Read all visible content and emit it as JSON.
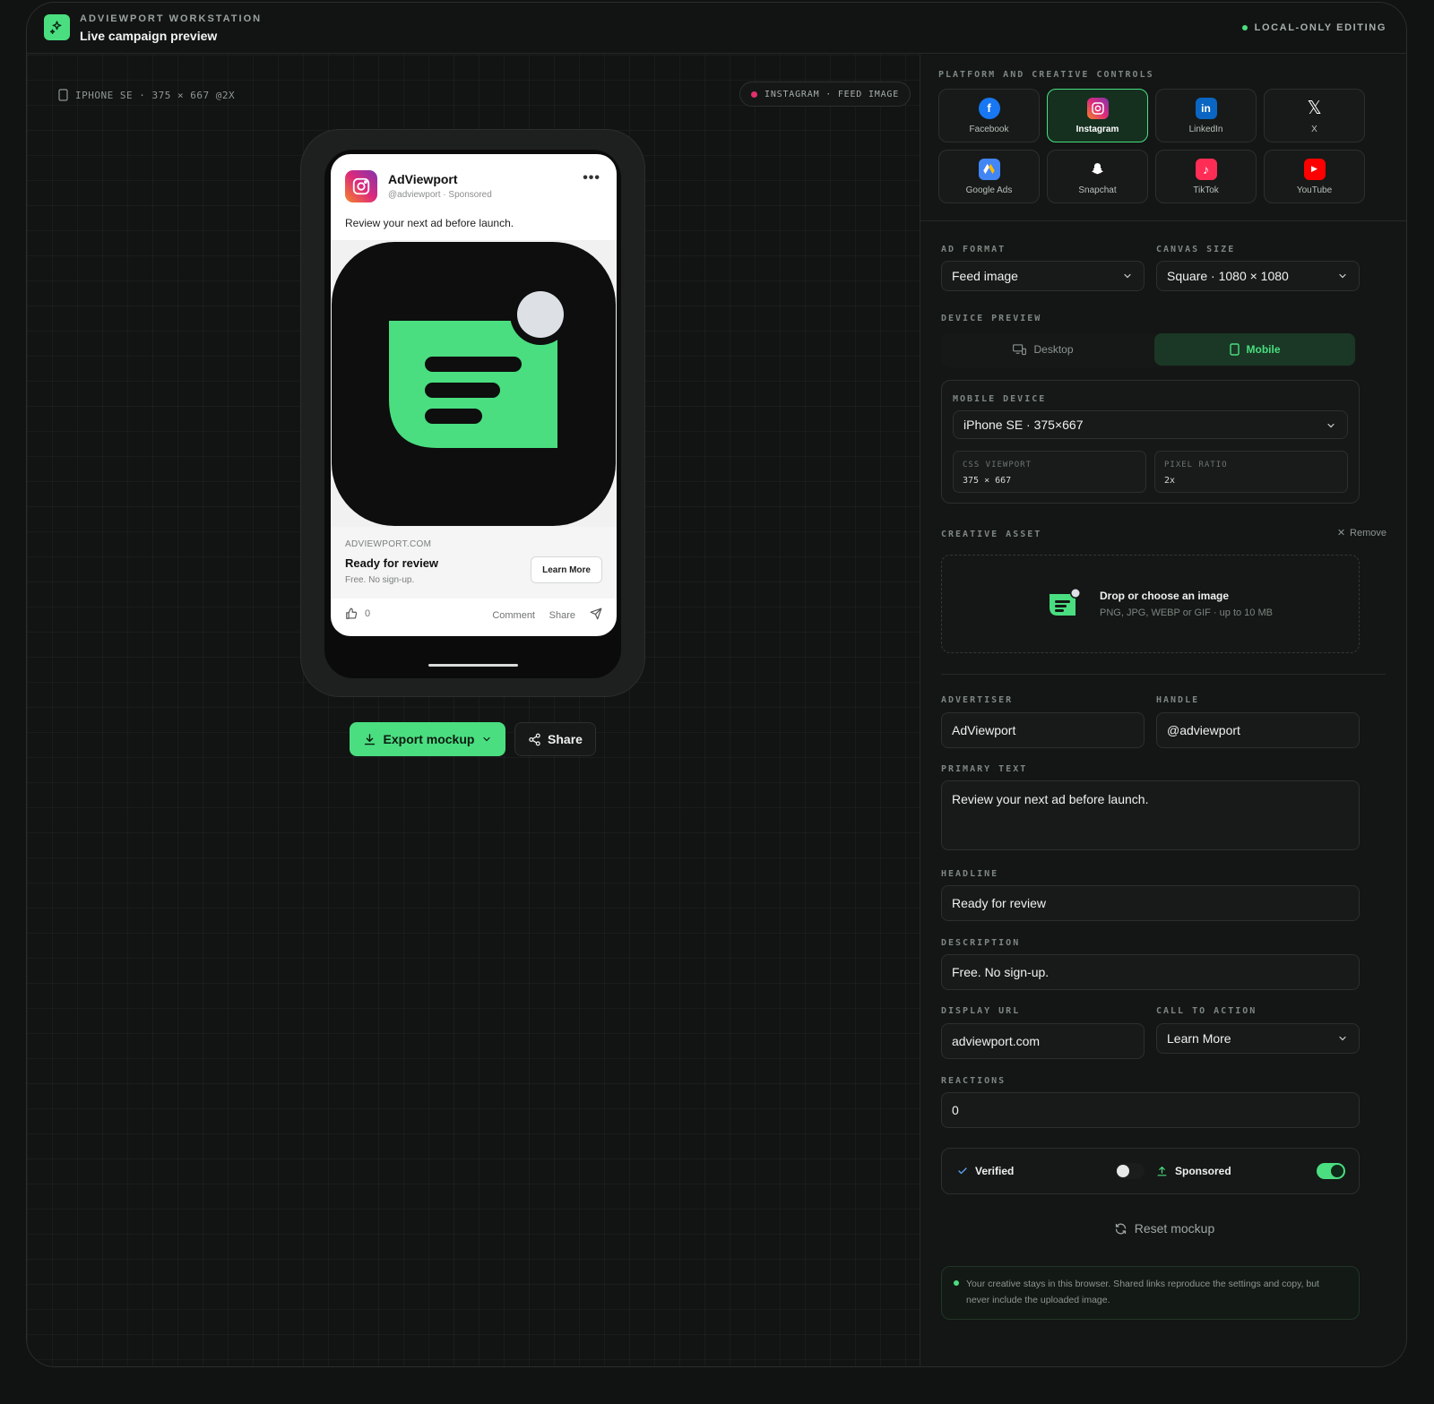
{
  "topbar": {
    "kicker": "ADVIEWPORT WORKSTATION",
    "title": "Live campaign preview",
    "status": "LOCAL-ONLY EDITING"
  },
  "stage": {
    "device_label": "IPHONE SE · 375 × 667 @2X",
    "platform_pill": "INSTAGRAM · FEED IMAGE",
    "export_label": "Export mockup",
    "share_label": "Share"
  },
  "post": {
    "advertiser": "AdViewport",
    "subline": "@adviewport · Sponsored",
    "primary_text": "Review your next ad before launch.",
    "display_url": "ADVIEWPORT.COM",
    "headline": "Ready for review",
    "description": "Free. No sign-up.",
    "cta": "Learn More",
    "reactions": "0",
    "comment": "Comment",
    "share": "Share"
  },
  "panel": {
    "controls_label": "PLATFORM AND CREATIVE CONTROLS",
    "platforms": [
      {
        "name": "Facebook",
        "icon": "facebook-icon",
        "color": "#1877f2",
        "active": false
      },
      {
        "name": "Instagram",
        "icon": "instagram-icon",
        "color": "#e1306c",
        "active": true
      },
      {
        "name": "LinkedIn",
        "icon": "linkedin-icon",
        "color": "#0a66c2",
        "active": false
      },
      {
        "name": "X",
        "icon": "x-icon",
        "color": "#000000",
        "active": false
      },
      {
        "name": "Google Ads",
        "icon": "google-ads-icon",
        "color": "#4285f4",
        "active": false
      },
      {
        "name": "Snapchat",
        "icon": "snapchat-icon",
        "color": "#fffc00",
        "active": false
      },
      {
        "name": "TikTok",
        "icon": "tiktok-icon",
        "color": "#ff2d55",
        "active": false
      },
      {
        "name": "YouTube",
        "icon": "youtube-icon",
        "color": "#ff0000",
        "active": false
      }
    ],
    "ad_format_label": "AD FORMAT",
    "ad_format": "Feed image",
    "canvas_size_label": "CANVAS SIZE",
    "canvas_size": "Square · 1080 × 1080",
    "device_preview_label": "DEVICE PREVIEW",
    "desktop_label": "Desktop",
    "mobile_label": "Mobile",
    "mobile_device_label": "MOBILE DEVICE",
    "mobile_device": "iPhone SE · 375×667",
    "css_viewport_label": "CSS VIEWPORT",
    "css_viewport": "375 × 667",
    "pixel_ratio_label": "PIXEL RATIO",
    "pixel_ratio": "2x",
    "creative_asset_label": "CREATIVE ASSET",
    "remove_label": "Remove",
    "drop_title": "Drop or choose an image",
    "drop_sub": "PNG, JPG, WEBP or GIF · up to 10 MB",
    "advertiser_label": "ADVERTISER",
    "advertiser": "AdViewport",
    "handle_label": "HANDLE",
    "handle": "@adviewport",
    "primary_text_label": "PRIMARY TEXT",
    "primary_text": "Review your next ad before launch.",
    "headline_label": "HEADLINE",
    "headline": "Ready for review",
    "description_label": "DESCRIPTION",
    "description": "Free. No sign-up.",
    "display_url_label": "DISPLAY URL",
    "display_url": "adviewport.com",
    "cta_label": "CALL TO ACTION",
    "cta": "Learn More",
    "reactions_label": "REACTIONS",
    "reactions": "0",
    "verified_label": "Verified",
    "verified_on": false,
    "sponsored_label": "Sponsored",
    "sponsored_on": true,
    "reset_label": "Reset mockup",
    "notice": "Your creative stays in this browser. Shared links reproduce the settings and copy, but never include the uploaded image."
  },
  "colors": {
    "accent": "#4ade80",
    "background": "#111312",
    "instagram": "#e1306c"
  }
}
